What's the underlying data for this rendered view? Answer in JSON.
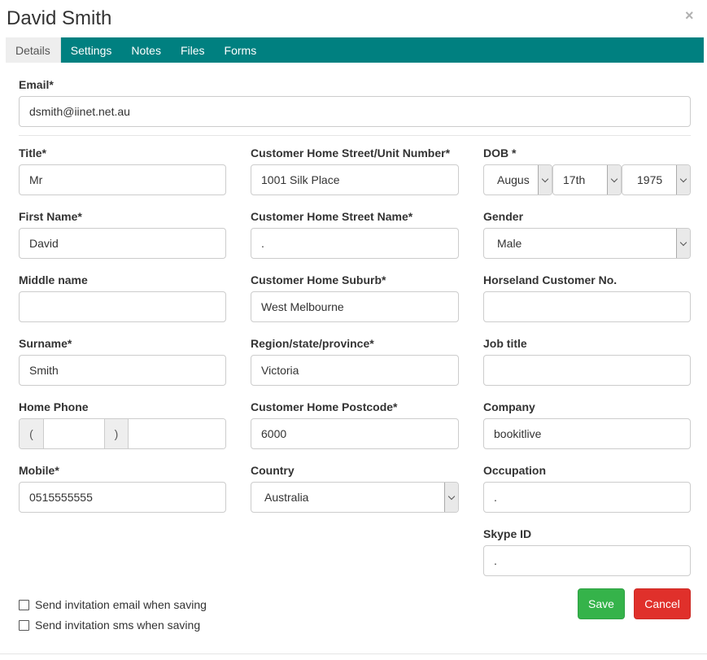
{
  "dialog": {
    "title": "David Smith",
    "close_glyph": "×"
  },
  "tabs": [
    {
      "label": "Details",
      "active": true
    },
    {
      "label": "Settings",
      "active": false
    },
    {
      "label": "Notes",
      "active": false
    },
    {
      "label": "Files",
      "active": false
    },
    {
      "label": "Forms",
      "active": false
    }
  ],
  "email": {
    "label": "Email*",
    "value": "dsmith@iinet.net.au"
  },
  "col1": {
    "title": {
      "label": "Title*",
      "value": "Mr"
    },
    "first_name": {
      "label": "First Name*",
      "value": "David"
    },
    "middle_name": {
      "label": "Middle name",
      "value": ""
    },
    "surname": {
      "label": "Surname*",
      "value": "Smith"
    },
    "home_phone": {
      "label": "Home Phone",
      "open_paren": "(",
      "close_paren": ")",
      "area": "",
      "number": ""
    },
    "mobile": {
      "label": "Mobile*",
      "value": "0515555555"
    }
  },
  "col2": {
    "street_unit": {
      "label": "Customer Home Street/Unit Number*",
      "value": "1001 Silk Place"
    },
    "street_name": {
      "label": "Customer Home Street Name*",
      "value": "."
    },
    "suburb": {
      "label": "Customer Home Suburb*",
      "value": "West Melbourne"
    },
    "region": {
      "label": "Region/state/province*",
      "value": "Victoria"
    },
    "postcode": {
      "label": "Customer Home Postcode*",
      "value": "6000"
    },
    "country": {
      "label": "Country",
      "value": "Australia"
    }
  },
  "col3": {
    "dob": {
      "label": "DOB *",
      "month": "Augus",
      "day": "17th",
      "year": "1975"
    },
    "gender": {
      "label": "Gender",
      "value": "Male"
    },
    "horseland_no": {
      "label": "Horseland Customer No.",
      "value": ""
    },
    "job_title": {
      "label": "Job title",
      "value": ""
    },
    "company": {
      "label": "Company",
      "value": "bookitlive"
    },
    "occupation": {
      "label": "Occupation",
      "value": "."
    },
    "skype": {
      "label": "Skype ID",
      "value": "."
    }
  },
  "options": {
    "invite_email": "Send invitation email when saving",
    "invite_sms": "Send invitation sms when saving"
  },
  "actions": {
    "save": "Save",
    "cancel": "Cancel"
  },
  "colors": {
    "tab_bar": "#008080",
    "save": "#35b34a",
    "cancel": "#e0302b"
  }
}
